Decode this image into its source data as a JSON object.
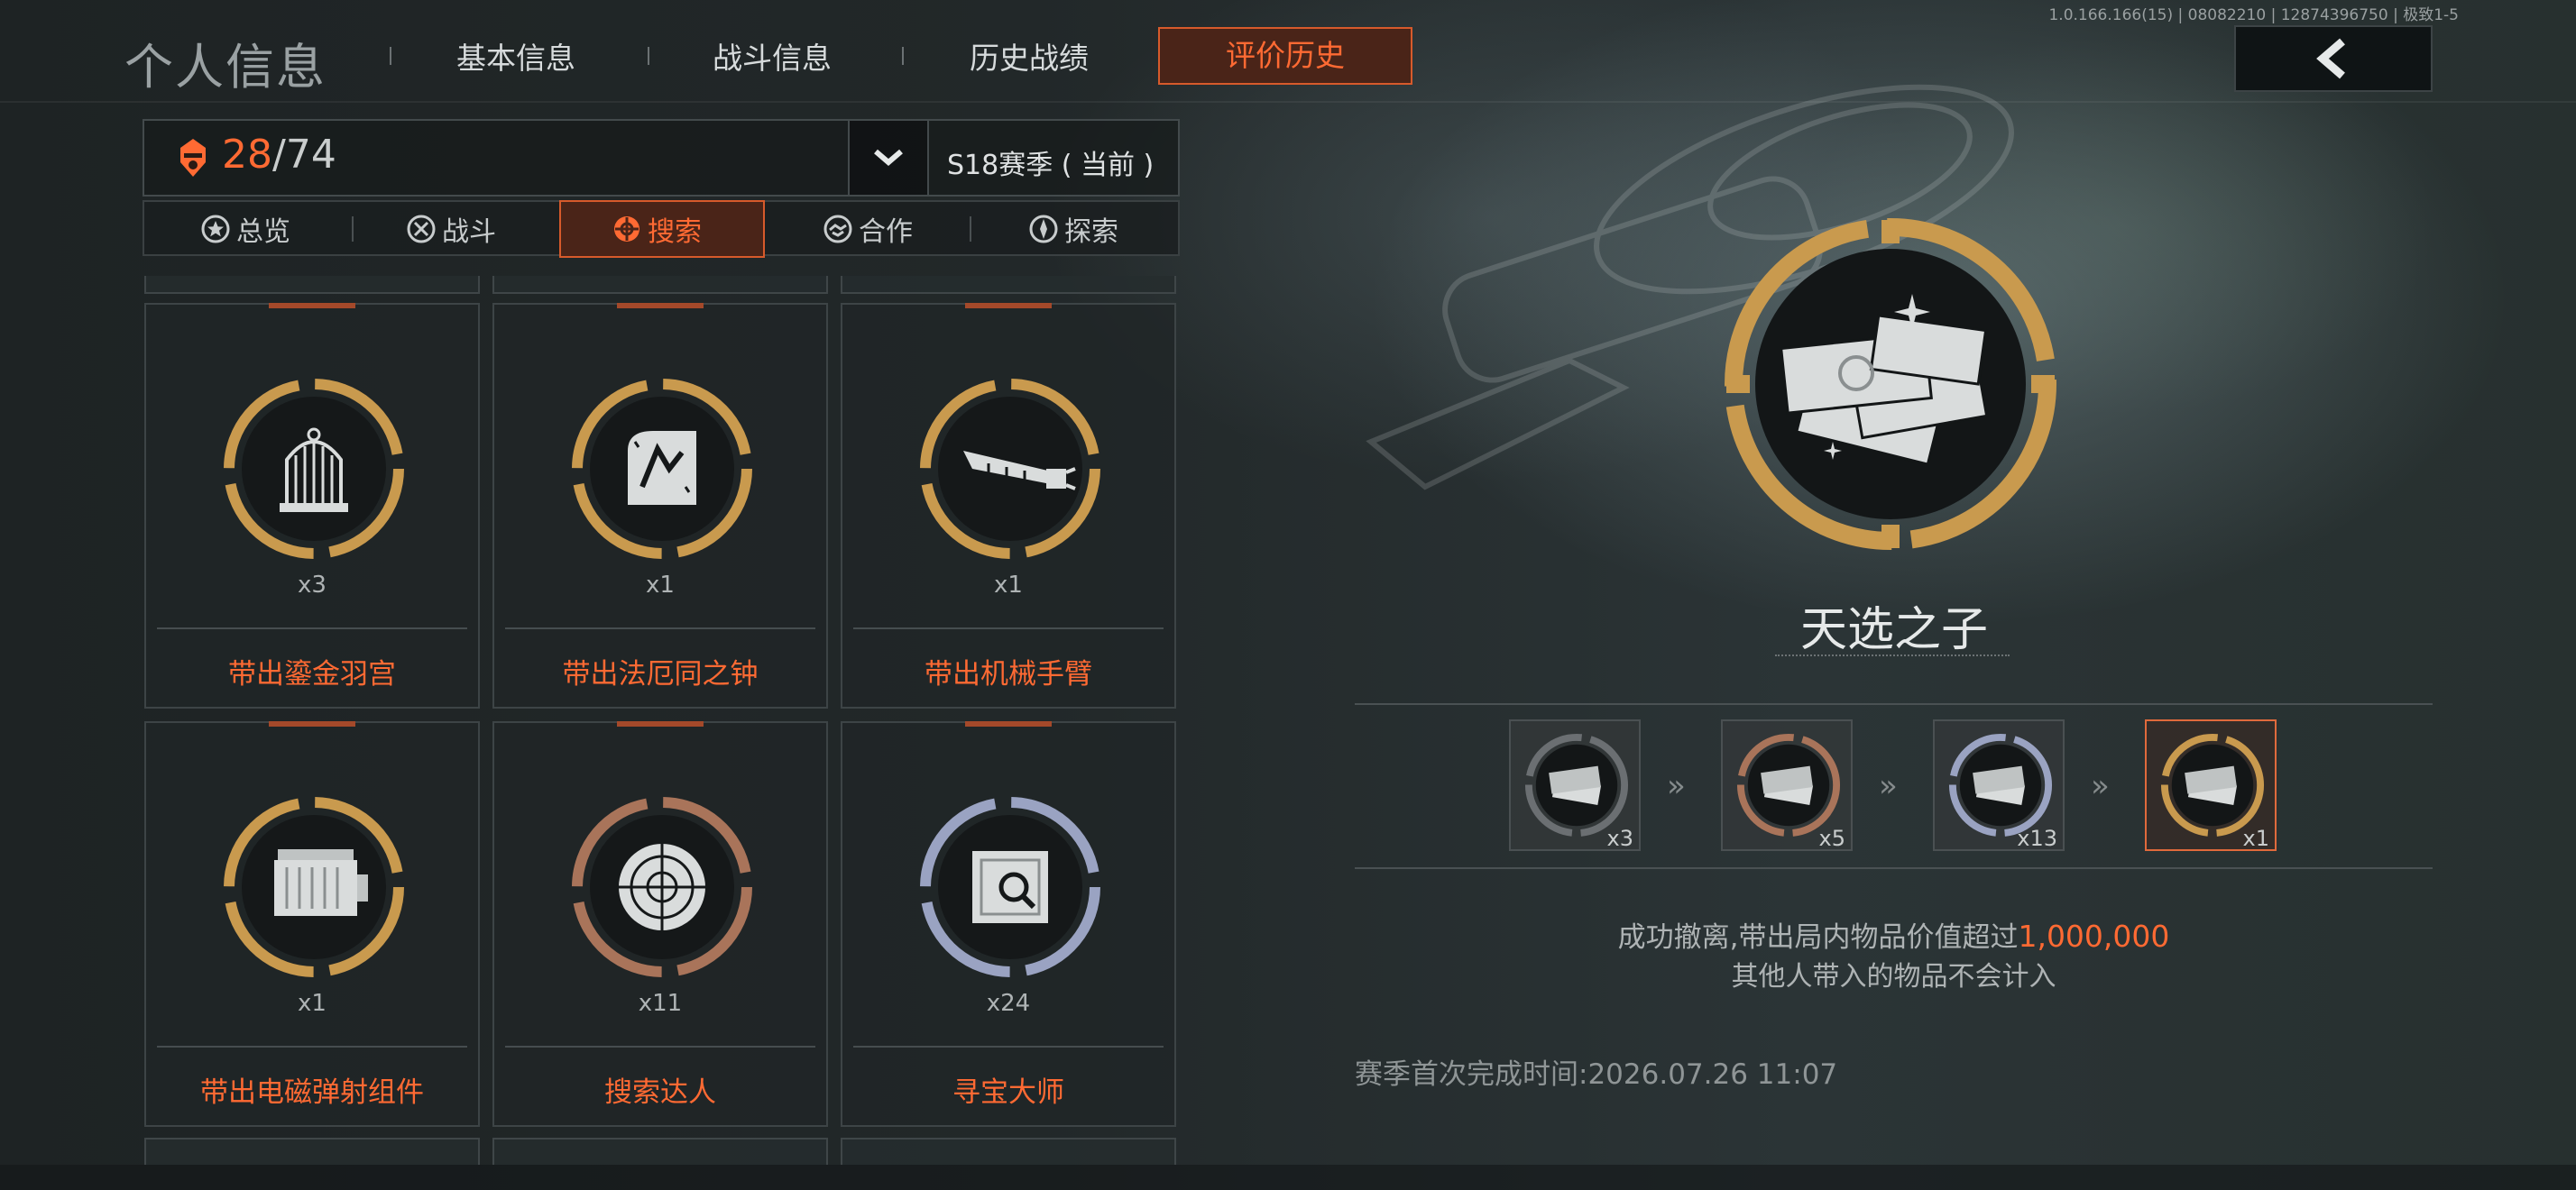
{
  "header": {
    "title": "个人信息",
    "tabs": [
      {
        "label": "基本信息"
      },
      {
        "label": "战斗信息"
      },
      {
        "label": "历史战绩"
      },
      {
        "label": "评价历史"
      }
    ],
    "build_info": "1.0.166.166(15) | 08082210 | 12874396750 | 极致1-5"
  },
  "summary": {
    "current": "28",
    "separator": "/",
    "total": "74",
    "season": "S18赛季 ( 当前 )"
  },
  "categories": [
    {
      "label": "总览",
      "icon": "star-circle-icon"
    },
    {
      "label": "战斗",
      "icon": "crossed-swords-icon"
    },
    {
      "label": "搜索",
      "icon": "search-target-icon"
    },
    {
      "label": "合作",
      "icon": "handshake-icon"
    },
    {
      "label": "探索",
      "icon": "compass-icon"
    }
  ],
  "cards": [
    {
      "name": "带出鎏金羽宫",
      "count": "x3",
      "icon": "birdcage-icon",
      "rim": "gold"
    },
    {
      "name": "带出法厄同之钟",
      "count": "x1",
      "icon": "relic-icon",
      "rim": "gold"
    },
    {
      "name": "带出机械手臂",
      "count": "x1",
      "icon": "mechanical-arm-icon",
      "rim": "gold"
    },
    {
      "name": "带出电磁弹射组件",
      "count": "x1",
      "icon": "engine-block-icon",
      "rim": "gold"
    },
    {
      "name": "搜索达人",
      "count": "x11",
      "icon": "radar-icon",
      "rim": "bronze"
    },
    {
      "name": "寻宝大师",
      "count": "x24",
      "icon": "safe-icon",
      "rim": "silver"
    }
  ],
  "detail": {
    "name": "天选之子",
    "icon": "money-stack-icon",
    "tiers": [
      {
        "count": "x3",
        "rim": "dark"
      },
      {
        "count": "x5",
        "rim": "bronze"
      },
      {
        "count": "x13",
        "rim": "silver"
      },
      {
        "count": "x1",
        "rim": "gold"
      }
    ],
    "desc_prefix": "成功撤离,带出局内物品价值超过",
    "desc_value": "1,000,000",
    "desc_line2": "其他人带入的物品不会计入",
    "season_time_label": "赛季首次完成时间:",
    "season_time_value": "2026.07.26 11:07"
  },
  "colors": {
    "accent": "#ff6a33",
    "gold": "#c99a4e",
    "bronze": "#a9745a",
    "silver": "#9aa3c2",
    "dark": "#6b6f72"
  }
}
